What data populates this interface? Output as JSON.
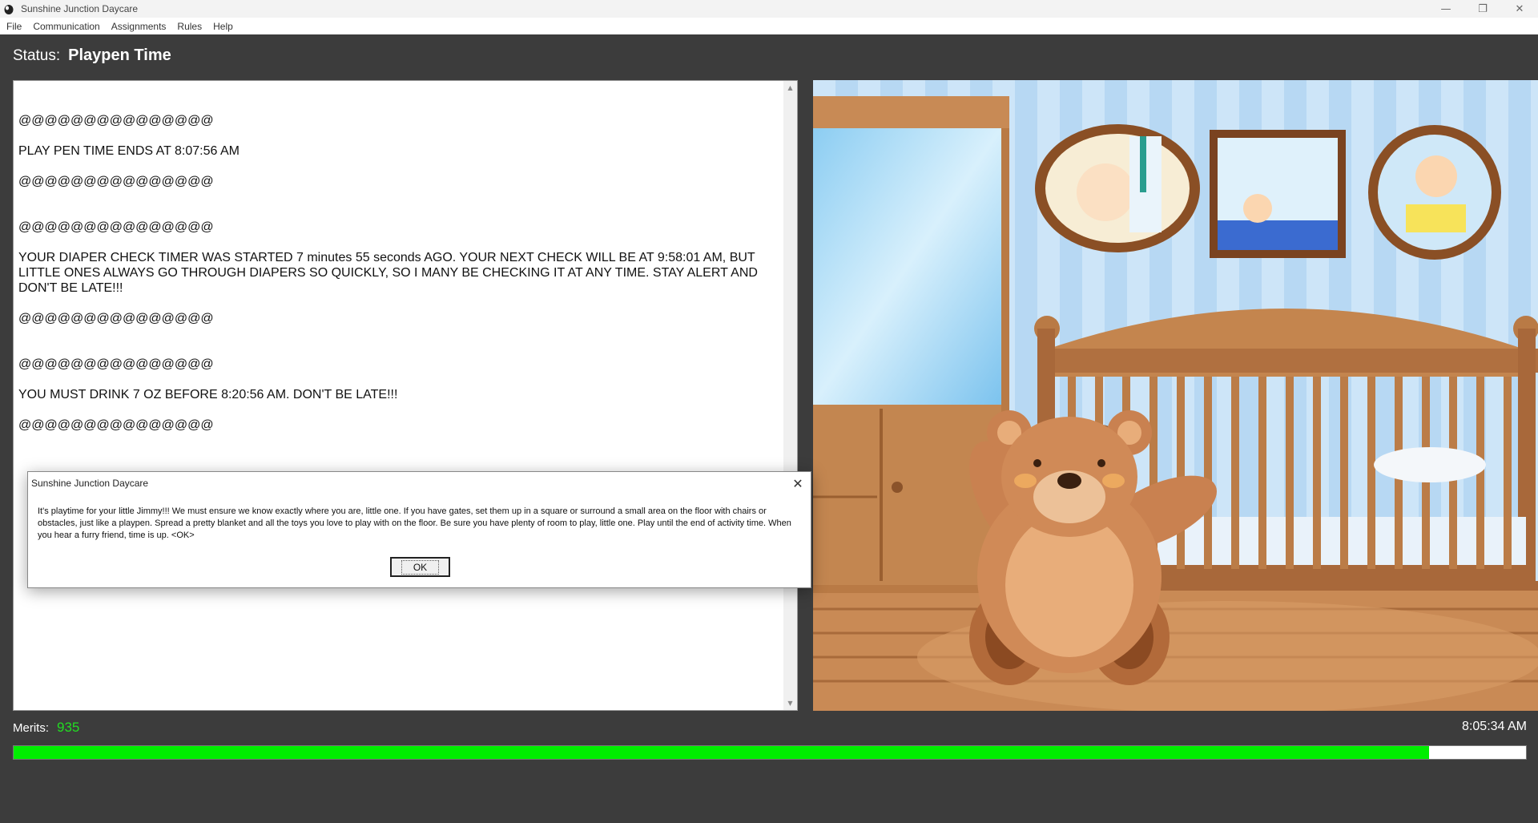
{
  "window": {
    "title": "Sunshine Junction Daycare",
    "controls": {
      "minimize": "—",
      "restore": "❐",
      "close": "✕"
    }
  },
  "menu": [
    "File",
    "Communication",
    "Assignments",
    "Rules",
    "Help"
  ],
  "status": {
    "label": "Status:",
    "value": "Playpen Time"
  },
  "log": [
    "@@@@@@@@@@@@@@@",
    "PLAY PEN TIME ENDS AT 8:07:56 AM",
    "@@@@@@@@@@@@@@@",
    "",
    "@@@@@@@@@@@@@@@",
    "YOUR DIAPER CHECK TIMER WAS STARTED 7 minutes 55 seconds AGO. YOUR NEXT CHECK WILL BE AT 9:58:01 AM, BUT LITTLE ONES ALWAYS GO THROUGH DIAPERS SO QUICKLY, SO I MANY BE CHECKING IT AT ANY TIME. STAY ALERT AND DON'T BE LATE!!!",
    "@@@@@@@@@@@@@@@",
    "",
    "@@@@@@@@@@@@@@@",
    "YOU MUST DRINK 7 OZ BEFORE 8:20:56 AM. DON'T BE LATE!!!",
    "@@@@@@@@@@@@@@@"
  ],
  "dialog": {
    "title": "Sunshine Junction Daycare",
    "message": "It's playtime for your little Jimmy!!! We must ensure we know exactly where you are, little one. If you have gates, set them up in a square or surround a small area on the floor with chairs or obstacles, just like a playpen. Spread a pretty blanket and all the toys you love to play with on the floor. Be sure you have plenty of room to play, little one. Play until the end of activity time. When you hear a furry friend, time is up. <OK>",
    "ok_label": "OK",
    "close_glyph": "✕"
  },
  "merits": {
    "label": "Merits:",
    "value": "935"
  },
  "clock": "8:05:34 AM",
  "progress": {
    "fraction": 0.936,
    "fill_color": "#00ee00"
  },
  "icons": {
    "app": "app-icon",
    "scroll_up": "scroll-up-arrow-icon",
    "scroll_down": "scroll-down-arrow-icon"
  },
  "colors": {
    "background": "#3c3c3c",
    "merits_value": "#22dd22",
    "progress_fill": "#00ee00"
  }
}
